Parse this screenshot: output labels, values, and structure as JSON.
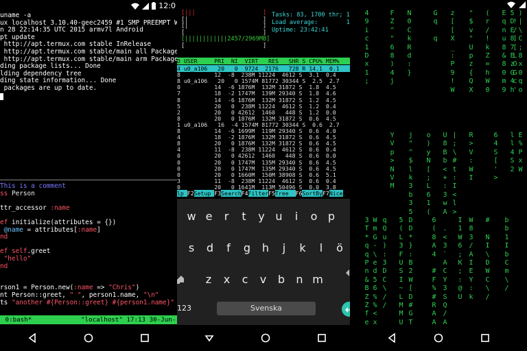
{
  "panel1": {
    "status_time": "12:0",
    "terminal_lines": [
      "uname -a",
      "ux localhost 3.10.40-geec2459 #1 SMP PREEMPT W",
      "n 28 22:14:35 UTC 2015 armv7l Android",
      "pt update",
      " http://apt.termux.com stable InRelease",
      " http://apt.termux.com stable/main all Package",
      " http://apt.termux.com stable/main arm Package",
      "ding package lists... Done",
      "lding dependency tree",
      "ding state information... Done",
      " packages are up to date."
    ],
    "code_lines": [
      [
        {
          "t": "This is a comment",
          "c": "comment"
        }
      ],
      [
        {
          "t": "ss ",
          "c": "kw"
        },
        {
          "t": "Person",
          "c": "cls"
        }
      ],
      [
        {
          "t": "",
          "c": "plain"
        }
      ],
      [
        {
          "t": "ttr_accessor ",
          "c": "plain"
        },
        {
          "t": ":name",
          "c": "sym"
        }
      ],
      [
        {
          "t": "",
          "c": "plain"
        }
      ],
      [
        {
          "t": "ef ",
          "c": "kw"
        },
        {
          "t": "initialize(attributes = {})",
          "c": "plain"
        }
      ],
      [
        {
          "t": " @name",
          "c": "ivar"
        },
        {
          "t": " = attributes[",
          "c": "plain"
        },
        {
          "t": ":name",
          "c": "sym"
        },
        {
          "t": "]",
          "c": "plain"
        }
      ],
      [
        {
          "t": "nd",
          "c": "kw"
        }
      ],
      [
        {
          "t": "",
          "c": "plain"
        }
      ],
      [
        {
          "t": "ef ",
          "c": "kw"
        },
        {
          "t": "self",
          "c": "kw"
        },
        {
          "t": ".greet",
          "c": "plain"
        }
      ],
      [
        {
          "t": " \"hello\"",
          "c": "str"
        }
      ],
      [
        {
          "t": "nd",
          "c": "kw"
        }
      ],
      [
        {
          "t": "",
          "c": "plain"
        }
      ],
      [
        {
          "t": "",
          "c": "plain"
        }
      ],
      [
        {
          "t": "rson1 = Person.new(",
          "c": "plain"
        },
        {
          "t": ":name",
          "c": "sym"
        },
        {
          "t": " => ",
          "c": "plain"
        },
        {
          "t": "\"Chris\"",
          "c": "str"
        },
        {
          "t": ")",
          "c": "plain"
        }
      ],
      [
        {
          "t": "nt Person::greet, ",
          "c": "plain"
        },
        {
          "t": "\" \"",
          "c": "str"
        },
        {
          "t": ", person1.name, ",
          "c": "plain"
        },
        {
          "t": "\"\\n\"",
          "c": "str"
        }
      ],
      [
        {
          "t": "ts ",
          "c": "plain"
        },
        {
          "t": "\"another #{Person::greet} #{person1.name}\"",
          "c": "str"
        }
      ]
    ],
    "tmux_left": " 0:bash*",
    "tmux_right": "\"localhost\" 17:13 30-Jun-"
  },
  "panel2": {
    "bars": [
      "[|||                   ]",
      "[|                     ]",
      "[|                     ]",
      "[                      ]",
      "[||||||||||||2457/2969MB]",
      "[                      ]"
    ],
    "tasks": "Tasks: 83, 1700 thr; 1",
    "load": "Load average:        11.",
    "uptime": "Uptime: 23:42:41",
    "header": "D USER     PRI  NI  VIRT   RES   SHR S CPU% MEM%",
    "rows": [
      "4 u0_a106   20   0  9724  2176   728 R 14.1  0.1",
      "8          12  -8  238M 11224  4612 S  3.1  0.4",
      "8 u0_a106   20   0 1574M 81772 30344 S  2.5  2.7",
      "0          14  -6 1876M  132M 31872 S  1.8  4.5",
      "7          18  -2 1747M  139M 29340 S  1.8  4.6",
      "8          14  -6 1876M  132M 31872 S  1.2  4.5",
      "5          20   0  238M 11224  4612 S  1.2  0.4",
      "2          20   0 42612  1460   448 S  1.2  0.0",
      "8          20   0 1876M  132M 31872 S  0.6  4.5",
      "1 u0_a106   16  -4 1574M 81772 30344 S  0.6  2.7",
      "8          14  -6 1699M  119M 29340 S  0.6  4.0",
      "4          18  -2 1876M  132M 31872 S  0.6  4.5",
      "8          20   0 1876M  132M 31872 S  0.6  4.5",
      "4          11  -8  238M 11224  4612 S  0.6  0.4",
      "0          20   0 42612  1460   448 S  0.6  0.0",
      "0          20   0 1747M  135M 29340 S  0.6  4.5",
      "0          20   0 1747M  135M 29340 S  0.6  4.5",
      "0          20   0 1660M  150M 38908 S  0.6  5.1",
      "3          11  -8  238M 11224  4612 S  0.6  0.4",
      "0          20   0 1641M  113M 50496 S  0.0  3.8"
    ],
    "fkeys": [
      {
        "n": "",
        "l": "lp "
      },
      {
        "n": "F2",
        "l": "Setup "
      },
      {
        "n": "F3",
        "l": "Search"
      },
      {
        "n": "F4",
        "l": "Filter"
      },
      {
        "n": "F5",
        "l": "Tree  "
      },
      {
        "n": "F6",
        "l": "SortBy"
      },
      {
        "n": "F7",
        "l": "Nice"
      }
    ],
    "keyboard": {
      "row1": [
        "w",
        "e",
        "r",
        "t",
        "y",
        "u",
        "i",
        "o",
        "p"
      ],
      "row2": [
        "s",
        "d",
        "f",
        "g",
        "h",
        "j",
        "k",
        "l",
        "ö"
      ],
      "row3": [
        "z",
        "x",
        "c",
        "v",
        "b",
        "n",
        "m"
      ],
      "num_label": "123",
      "space_label": "Svenska"
    }
  },
  "panel3": {
    "columns": [
      "4\n9\ni\nc\n1\nD\nx\n1\n;",
      "F\nZ\n^\n\"\n6\n8\n)\n4\nj",
      "N\n0\nC\nk\nR\nd\n:\n}\n \n ",
      "G\nq\n\nq\n \n \n \n \n \n ",
      "z\n[\n[\nX\n_\n:\nP\n9\n!\nW",
      "\"\n$\nv\n\"\nU\np\nz\n{\nQ\nX",
      "(\nr\n/\n!\nk\nZ\n=\nh\nW\n0",
      "E\nq\nn\nu\n8\n&\n8\n0\nm\n9",
      "5\nD\nE\n8\n7\nE\nz\nG\n4\nh",
      ")\n|\n\\\nC\n;\n8\nx\n0\nq\no",
      "\n!\n/\n]\n[\nL\nO\nG\nc\n'"
    ],
    "columns_low": [
      "Y\nV\np\n>\nN\nV\nM",
      "j\n\"\n^\n$\nl\nk\n3\nb\n3\n5",
      "o\n)\ny\nN\n[\n;\nL\n6\n1\n(",
      "U\n8\nB\nb\n<\n+\n:\n3\nw\nA",
      "|\n;\n\\\n#\nt\n:\nI\n<\nl\n>",
      "R\n>\nV\n:\nW\nI",
      "6\n4\nS\n[\n'\n>",
      "l\nl\n4\nS\n2",
      "E\n%\nP\nx\nW"
    ],
    "bottom_cols": [
      "3\nT\n*\nq\nq\nP\nn\n&\nB\nZ\nZ\nf\ne\nZ",
      "W\nm\nG\n-\n\\\ne\nd\n5\n6\n%\n%\n<\nx\nZ",
      "q\nQ\nu\n)\n:\n3\nD\nC\n\\\n/\n/",
      "5\n(\nL\n3\nF\nU\nS\nI\n~\nL\nM\nM\nU",
      "D\nD\n*\n}\n:\nB\n2\nW\n[\nD\n#\nG\nT",
      "6\n(\n8\nA\n4\n\n#\nF\n%\n#\nR\nA\nA",
      "\n.\n<\n3\n`\nA\nC\nY\n3\nS\nQ\n/\nA",
      "I\n1\nW\n6\n;\nK\n;\n:\n@\nU",
      "W\n8\n3\n/\nA\nI\nE\nY\n:\nk",
      "#\n\nN\nI\n\\\nD\nW\nC\n\\\n/",
      "b\nb\n1\nI\nb\nC\nm\n\\\n/"
    ]
  }
}
